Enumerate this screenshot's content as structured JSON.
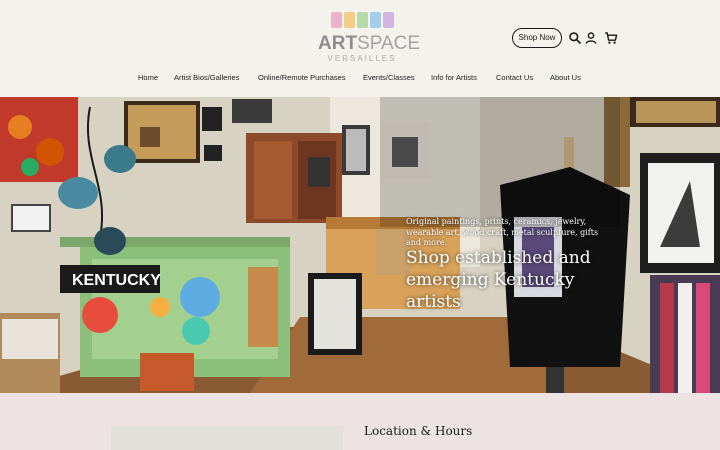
{
  "brand": {
    "logo_main_bold": "ART",
    "logo_main_light": "SPACE",
    "logo_sub": "VERSAILLES",
    "logo_colors": [
      "#e9a3c0",
      "#f2c26b",
      "#a8d39a",
      "#8fc3e6",
      "#c8a6dc"
    ]
  },
  "header": {
    "shop_now_label": "Shop Now",
    "icons": [
      "search-icon",
      "account-icon",
      "cart-icon"
    ]
  },
  "nav": {
    "items": [
      {
        "label": "Home"
      },
      {
        "label": "Artist Bios/Galleries"
      },
      {
        "label": "Online/Remote Purchases"
      },
      {
        "label": "Events/Classes"
      },
      {
        "label": "Info for Artists"
      },
      {
        "label": "Contact Us"
      },
      {
        "label": "About Us"
      }
    ]
  },
  "hero": {
    "subtitle": "Original paintings, prints, ceramics, jewelry, wearable art, wood craft, metal sculpture, gifts and more.",
    "title": "Shop established and emerging Kentucky artists",
    "sign_text": "KENTUCKY"
  },
  "location": {
    "title": "Location & Hours"
  },
  "colors": {
    "background": "#f3f1ec",
    "footer_band": "#ede3e3",
    "text": "#1a1a1a"
  }
}
